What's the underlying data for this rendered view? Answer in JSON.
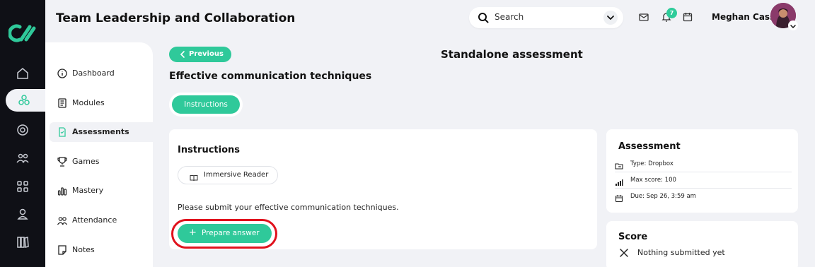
{
  "header": {
    "course_title": "Team Leadership and Collaboration",
    "search_placeholder": "Search",
    "notification_count": "7",
    "user_name": "Meghan Cass"
  },
  "sidebar": {
    "items": [
      {
        "label": "Dashboard",
        "icon": "info-circle-icon"
      },
      {
        "label": "Modules",
        "icon": "book-icon"
      },
      {
        "label": "Assessments",
        "icon": "document-icon",
        "active": true
      },
      {
        "label": "Games",
        "icon": "trophy-icon"
      },
      {
        "label": "Mastery",
        "icon": "bar-chart-icon"
      },
      {
        "label": "Attendance",
        "icon": "people-icon"
      },
      {
        "label": "Notes",
        "icon": "note-icon"
      }
    ]
  },
  "rail": {
    "items": [
      "home-icon",
      "modules-cluster-icon",
      "target-icon",
      "group-icon",
      "grid-icon",
      "user-icon",
      "library-icon"
    ],
    "active_index": 1
  },
  "main": {
    "previous_label": "Previous",
    "page_title": "Standalone assessment",
    "assessment_title": "Effective communication techniques",
    "tab_label": "Instructions",
    "instructions_title": "Instructions",
    "reader_label": "Immersive Reader",
    "instruction_text": "Please submit your effective communication techniques.",
    "prepare_label": "Prepare answer"
  },
  "assessment_card": {
    "title": "Assessment",
    "type": "Type: Dropbox",
    "max_score": "Max score: 100",
    "due": "Due: Sep 26, 3:59 am"
  },
  "score_card": {
    "title": "Score",
    "status": "Nothing submitted yet"
  },
  "colors": {
    "accent": "#2fc99a",
    "rail_bg": "#0f1016",
    "page_bg": "#f1f2f6",
    "highlight": "#e0121d"
  }
}
